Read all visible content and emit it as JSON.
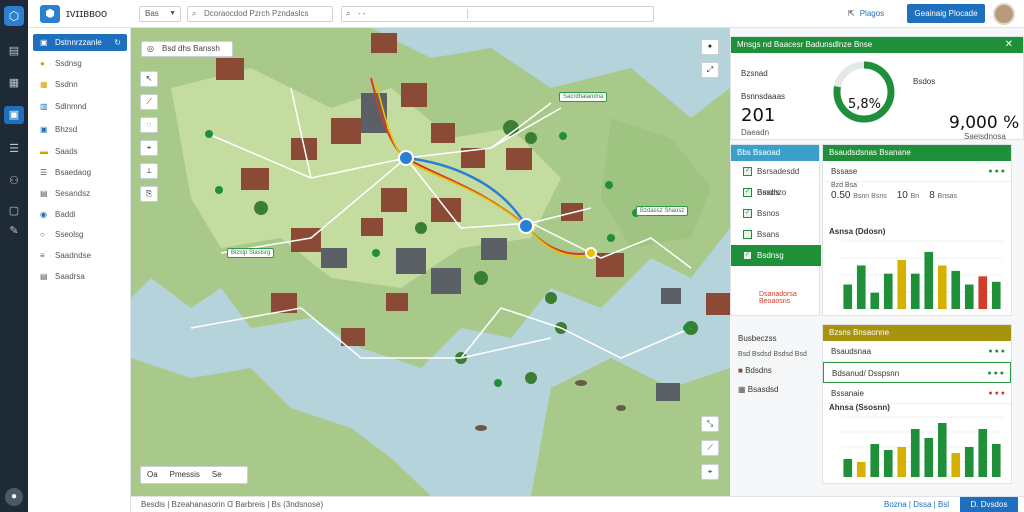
{
  "app": {
    "brand_name": "ɪvɪɪʙʙᴏᴏ",
    "select_value": "Bas",
    "search_placeholder": "Dcoraocdod Pzrch Pzndaslcs",
    "search2_placeholder": "- -",
    "share_label": "Plagos",
    "primary_button": "Geainaig Plocade"
  },
  "nav": {
    "items": [
      {
        "label": "Dstnnrzzanle",
        "icon": "map-icon",
        "active": true
      },
      {
        "label": "Ssdnsg",
        "icon": "circle-icon"
      },
      {
        "label": "Ssdnn",
        "icon": "grid-icon"
      },
      {
        "label": "Sdlnmnd",
        "icon": "chart-icon"
      },
      {
        "label": "Bhzsd",
        "icon": "box-icon"
      },
      {
        "label": "Saads",
        "icon": "folder-icon"
      },
      {
        "label": "Bsaedaog",
        "icon": "list-icon"
      },
      {
        "label": "Sesandsz",
        "icon": "doc-icon"
      },
      {
        "label": "Baddi",
        "icon": "globe-icon"
      },
      {
        "label": "Sseolsg",
        "icon": "circle-icon"
      },
      {
        "label": "Saadndse",
        "icon": "sliders-icon"
      },
      {
        "label": "Saadrsa",
        "icon": "doc-icon"
      }
    ]
  },
  "map": {
    "chip_label": "Bsd dhs Banssh",
    "legend": [
      "Oa",
      "Pmessis",
      "Se"
    ],
    "labels": [
      {
        "text": "Sacrdhalandna"
      },
      {
        "text": "Bzdassz Shaosz"
      },
      {
        "text": "Blzstp Slaslsrg"
      }
    ]
  },
  "statusbar": {
    "left": "Besdis  |  Bzeahanasorin  Ɑ  Barbreis  |  Bs  (3ndsnose)",
    "mid": "Bozna  |  Dssa  |  Bsl",
    "button": "D. Dvsdos"
  },
  "panel": {
    "header": "Mnsgs nd Baacesr Badunsdlnze Bnse",
    "kpi1": {
      "label": "Bzsnad",
      "sub": "Bsnnsdaaas",
      "value": "201",
      "value_sub": "Daeadn"
    },
    "gauge": {
      "value": "5,8%",
      "fraction": 0.78
    },
    "kpi2": {
      "label": "Bsdos",
      "value": "9,000 %",
      "sub": "Saeisdnosa"
    },
    "list": {
      "header": "Bbs Bsaoad",
      "items": [
        {
          "label": "Bsrsadesdd Bmdnzo"
        },
        {
          "label": "Bsads"
        },
        {
          "label": "Bsnos"
        },
        {
          "label": "Bsans"
        },
        {
          "label": "Bsdnsg"
        }
      ],
      "warn": "Dsanadorsa Beoaosns"
    },
    "card2": {
      "header": "Bsaudsdsnas Bsanane",
      "row1_label": "Bssase",
      "row1_sub": "Bzd Bsa",
      "vals": [
        {
          "v": "0.50",
          "u": "Bsnn Bsns"
        },
        {
          "v": "10",
          "u": "Bn"
        },
        {
          "v": "8",
          "u": "Bnsas"
        }
      ]
    },
    "chart1": {
      "title": "Asnsa (Ddosn)"
    },
    "chart2": {
      "title": "Ahnsa (Ssosnn)"
    },
    "card3": {
      "header": "Bzsns Bnsaonne",
      "rows": [
        {
          "label": "Bsaudsnaa"
        },
        {
          "label": "Bdsanud/ Dsspsnn"
        },
        {
          "label": "Bssanaie"
        }
      ]
    },
    "section": {
      "title": "Busbeczss",
      "sub": "Bsd Bsdsd Bsdsd Bsd",
      "items": [
        "Bdsdns",
        "Bsasdsd"
      ]
    }
  },
  "chart_data": [
    {
      "type": "bar",
      "title": "Asnsa (Ddosn)",
      "categories": [
        "1",
        "2",
        "3",
        "4",
        "5",
        "6",
        "7",
        "8",
        "9",
        "10",
        "11"
      ],
      "values": [
        9,
        16,
        6,
        13,
        18,
        13,
        21,
        16,
        14,
        9,
        12,
        10
      ],
      "colors": [
        "#1f8f3a",
        "#1f8f3a",
        "#1f8f3a",
        "#1f8f3a",
        "#d8b000",
        "#1f8f3a",
        "#1f8f3a",
        "#d8b000",
        "#1f8f3a",
        "#1f8f3a",
        "#d23c2a"
      ],
      "ylim": [
        0,
        25
      ]
    },
    {
      "type": "bar",
      "title": "Ahnsa (Ssosnn)",
      "categories": [
        "1",
        "2",
        "3",
        "4",
        "5",
        "6",
        "7",
        "8",
        "9",
        "10",
        "11"
      ],
      "values": [
        6,
        5,
        11,
        9,
        10,
        16,
        13,
        18,
        8,
        10,
        16,
        11
      ],
      "colors": [
        "#1f8f3a",
        "#d8b000",
        "#1f8f3a",
        "#1f8f3a",
        "#d8b000",
        "#1f8f3a",
        "#1f8f3a",
        "#1f8f3a",
        "#d8b000",
        "#1f8f3a",
        "#1f8f3a"
      ],
      "ylim": [
        0,
        20
      ]
    }
  ]
}
